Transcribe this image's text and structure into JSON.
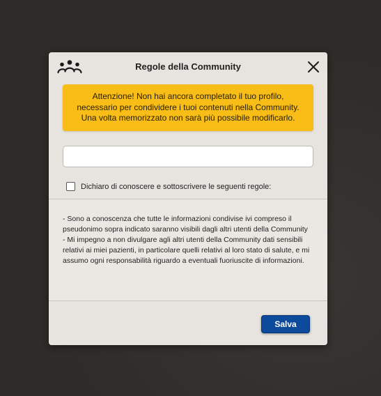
{
  "modal": {
    "title": "Regole della Community",
    "warning": "Attenzione! Non hai ancora completato il tuo profilo, necessario per condividere i tuoi contenuti nella Community. Una volta memorizzato non sarà più possibile modificarlo.",
    "pseudonym_value": "",
    "checkbox_label": "Dichiaro di conoscere e sottoscrivere le seguenti regole:",
    "checkbox_checked": false,
    "rules": [
      "- Sono a conoscenza che tutte le informazioni condivise ivi compreso il pseudonimo sopra indicato saranno visibili dagli altri utenti della Community",
      "- Mi impegno a non divulgare agli altri utenti della Community dati sensibili relativi ai miei pazienti, in particolare quelli relativi al loro stato di salute, e mi assumo ogni responsabilità riguardo a eventuali fuoriuscite di informazioni."
    ],
    "save_label": "Salva"
  },
  "icons": {
    "header": "community-icon",
    "close": "close-icon"
  },
  "colors": {
    "warning": "#f8bd16",
    "save_button": "#0c4a9c",
    "modal_bg": "#e7e3df",
    "page_bg": "#2e2b28"
  }
}
